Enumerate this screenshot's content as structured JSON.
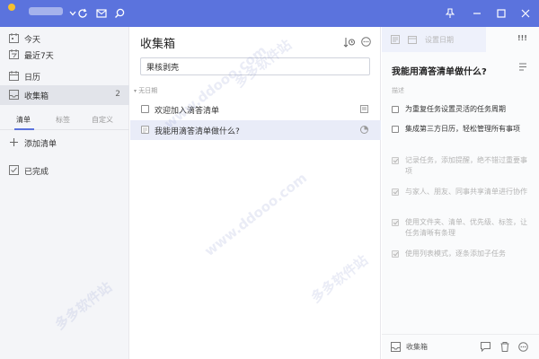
{
  "app": {
    "accent": "#5b73dd",
    "username": "",
    "icons": [
      "chevron-down-icon",
      "sync-icon",
      "mail-icon",
      "search-icon",
      "pin-icon",
      "minimize-icon",
      "maximize-icon",
      "close-icon"
    ]
  },
  "sidebar": {
    "items": [
      {
        "label": "今天",
        "icon": "today-icon"
      },
      {
        "label": "最近7天",
        "icon": "week-icon"
      },
      {
        "label": "日历",
        "icon": "calendar-icon"
      },
      {
        "label": "收集箱",
        "icon": "inbox-icon",
        "count": "2"
      }
    ],
    "tabs": [
      "清单",
      "标签",
      "自定义"
    ],
    "add_list_label": "添加清单",
    "completed_label": "已完成"
  },
  "list": {
    "title": "收集箱",
    "input_value": "果核剥壳",
    "section_label": "无日期",
    "tasks": [
      {
        "title": "欢迎加入滴答清单"
      },
      {
        "title": "我能用滴答清单做什么?"
      }
    ]
  },
  "detail": {
    "date_placeholder": "设置日期",
    "title": "我能用滴答清单做什么?",
    "description_placeholder": "描述",
    "subtasks": [
      {
        "text": "为重复任务设置灵活的任务周期",
        "done": false
      },
      {
        "text": "集成第三方日历，轻松管理所有事项",
        "done": false
      },
      {
        "text": "记录任务，添加提醒，绝不错过重要事项",
        "done": true
      },
      {
        "text": "与家人、朋友、同事共享清单进行协作",
        "done": true
      },
      {
        "text": "使用文件夹、清单、优先级、标签，让任务清晰有条理",
        "done": true
      },
      {
        "text": "使用列表模式，逐条添加子任务",
        "done": true
      }
    ],
    "footer_list": "收集箱"
  },
  "watermark": [
    "多多软件站",
    "www.ddooo.com"
  ]
}
